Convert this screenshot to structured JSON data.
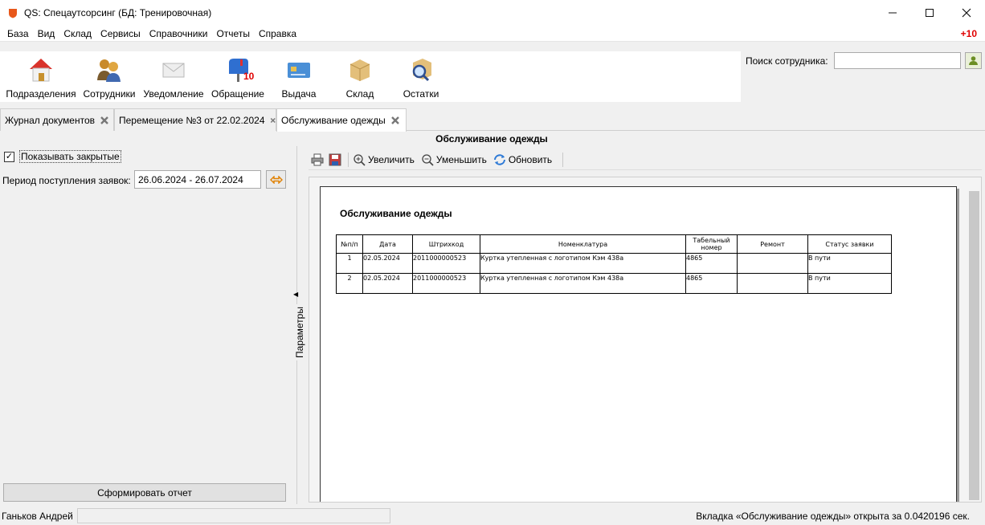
{
  "window": {
    "title": "QS: Спецаутсорсинг (БД: Тренировочная)",
    "minimize_icon": "minimize-icon",
    "maximize_icon": "maximize-icon",
    "close_icon": "close-icon"
  },
  "menu": {
    "items": [
      "База",
      "Вид",
      "Склад",
      "Сервисы",
      "Справочники",
      "Отчеты",
      "Справка"
    ],
    "badge": "+10"
  },
  "toolbar": {
    "items": [
      {
        "label": "Подразделения",
        "icon": "house-icon"
      },
      {
        "label": "Сотрудники",
        "icon": "people-icon"
      },
      {
        "label": "Уведомление",
        "icon": "envelope-icon"
      },
      {
        "label": "Обращение",
        "icon": "mailbox-icon",
        "badge": "10"
      },
      {
        "label": "Выдача",
        "icon": "card-icon"
      },
      {
        "label": "Склад",
        "icon": "box-icon"
      },
      {
        "label": "Остатки",
        "icon": "magnifier-icon"
      }
    ]
  },
  "search": {
    "label": "Поиск сотрудника:",
    "value": "",
    "placeholder": ""
  },
  "tabs": [
    {
      "label": "Журнал документов",
      "active": false
    },
    {
      "label": "Перемещение №3 от 22.02.2024",
      "active": false
    },
    {
      "label": "Обслуживание одежды",
      "active": true
    }
  ],
  "params": {
    "show_closed_label": "Показывать закрытые",
    "show_closed_checked": true,
    "period_label": "Период поступления заявок:",
    "period_value": "26.06.2024 - 26.07.2024",
    "generate_button": "Сформировать отчет",
    "panel_label": "Параметры"
  },
  "report": {
    "header_title": "Обслуживание одежды",
    "toolbar": {
      "zoom_in": "Увеличить",
      "zoom_out": "Уменьшить",
      "refresh": "Обновить"
    },
    "page_title": "Обслуживание одежды",
    "columns": [
      "№п/п",
      "Дата",
      "Штрихкод",
      "Номенклатура",
      "Табельный номер",
      "Ремонт",
      "Статус заявки"
    ],
    "rows": [
      [
        "1",
        "02.05.2024",
        "2011000000523",
        "Куртка утепленная с логотипом Кэм 438а",
        "4865",
        "",
        "В пути"
      ],
      [
        "2",
        "02.05.2024",
        "2011000000523",
        "Куртка утепленная с логотипом Кэм 438а",
        "4865",
        "",
        "В пути"
      ]
    ]
  },
  "status": {
    "user": "Ганьков Андрей",
    "message": "Вкладка «Обслуживание одежды» открыта за 0.0420196 сек."
  },
  "colors": {
    "accent_red": "#e00000",
    "app_icon": "#e8571a"
  }
}
